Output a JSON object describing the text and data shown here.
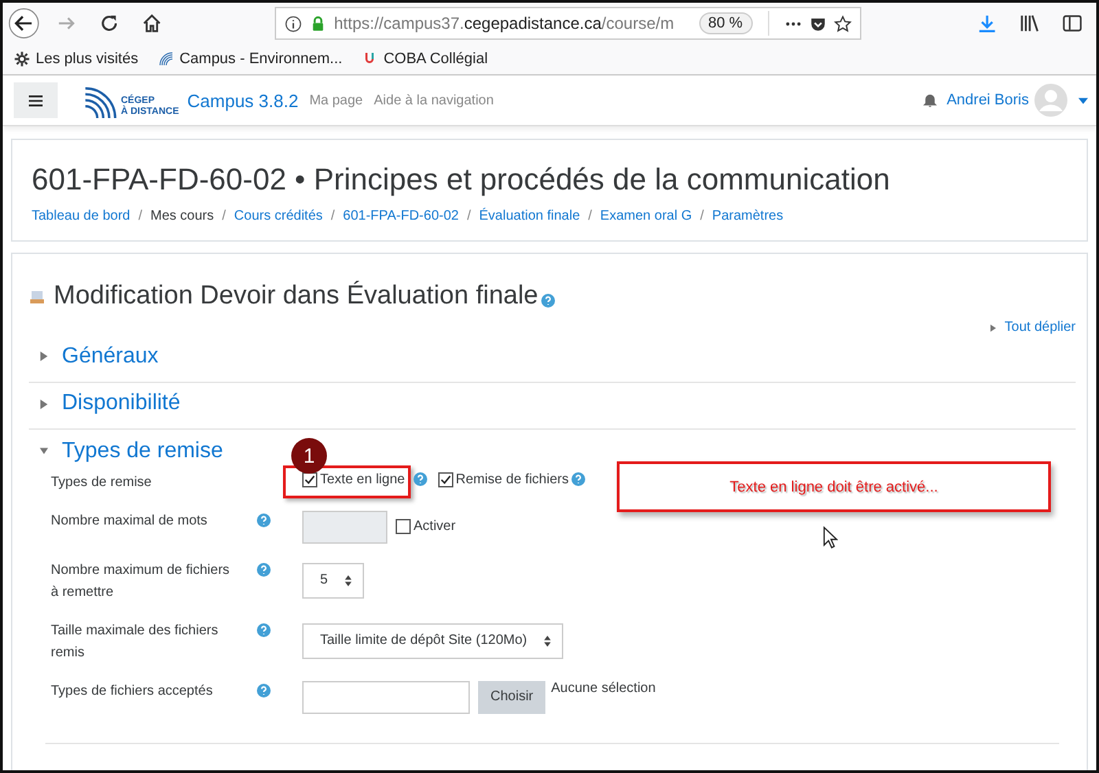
{
  "browser": {
    "address": {
      "url_prefix": "https://campus37.",
      "url_domain": "cegepadistance.ca",
      "url_path": "/course/m"
    },
    "zoom": "80 %",
    "bookmarks": [
      {
        "label": "Les plus visités",
        "kind": "gear"
      },
      {
        "label": "Campus - Environnem...",
        "kind": "campus"
      },
      {
        "label": "COBA Collégial",
        "kind": "coba"
      }
    ]
  },
  "navbar": {
    "logo": [
      "CÉGEP",
      "À DISTANCE"
    ],
    "site_name": "Campus 3.8.2",
    "links": [
      "Ma page",
      "Aide à la navigation"
    ],
    "user": "Andrei Boris"
  },
  "header": {
    "title": "601-FPA-FD-60-02 • Principes et procédés de la communication",
    "breadcrumb": [
      {
        "label": "Tableau de bord",
        "link": true
      },
      {
        "label": "Mes cours",
        "link": false
      },
      {
        "label": "Cours crédités",
        "link": true
      },
      {
        "label": "601-FPA-FD-60-02",
        "link": true
      },
      {
        "label": "Évaluation finale",
        "link": true
      },
      {
        "label": "Examen oral G",
        "link": true
      },
      {
        "label": "Paramètres",
        "link": true
      }
    ],
    "separator": "/"
  },
  "form": {
    "heading": "Modification Devoir dans Évaluation finale",
    "expand_all": "Tout déplier",
    "sections": [
      {
        "title": "Généraux",
        "expanded": false
      },
      {
        "title": "Disponibilité",
        "expanded": false
      },
      {
        "title": "Types de remise",
        "expanded": true
      }
    ],
    "fields": [
      {
        "kind": "checkboxes",
        "label": "Types de remise",
        "options": [
          {
            "label": "Texte en ligne",
            "checked": true,
            "highlighted": true
          },
          {
            "label": "Remise de fichiers",
            "checked": true,
            "highlighted": false
          }
        ]
      },
      {
        "kind": "number_toggle",
        "label": "Nombre maximal de mots",
        "toggle": {
          "label": "Activer",
          "checked": false
        }
      },
      {
        "kind": "select",
        "label": "Nombre maximum de fichiers à remettre",
        "value": "5"
      },
      {
        "kind": "select",
        "label": "Taille maximale des fichiers remis",
        "value": "Taille limite de dépôt Site (120Mo)"
      },
      {
        "kind": "filepicker",
        "label": "Types de fichiers acceptés",
        "button": "Choisir",
        "status": "Aucune sélection"
      }
    ]
  },
  "annotations": {
    "badge": "1",
    "callout": "Texte en ligne doit être activé..."
  }
}
